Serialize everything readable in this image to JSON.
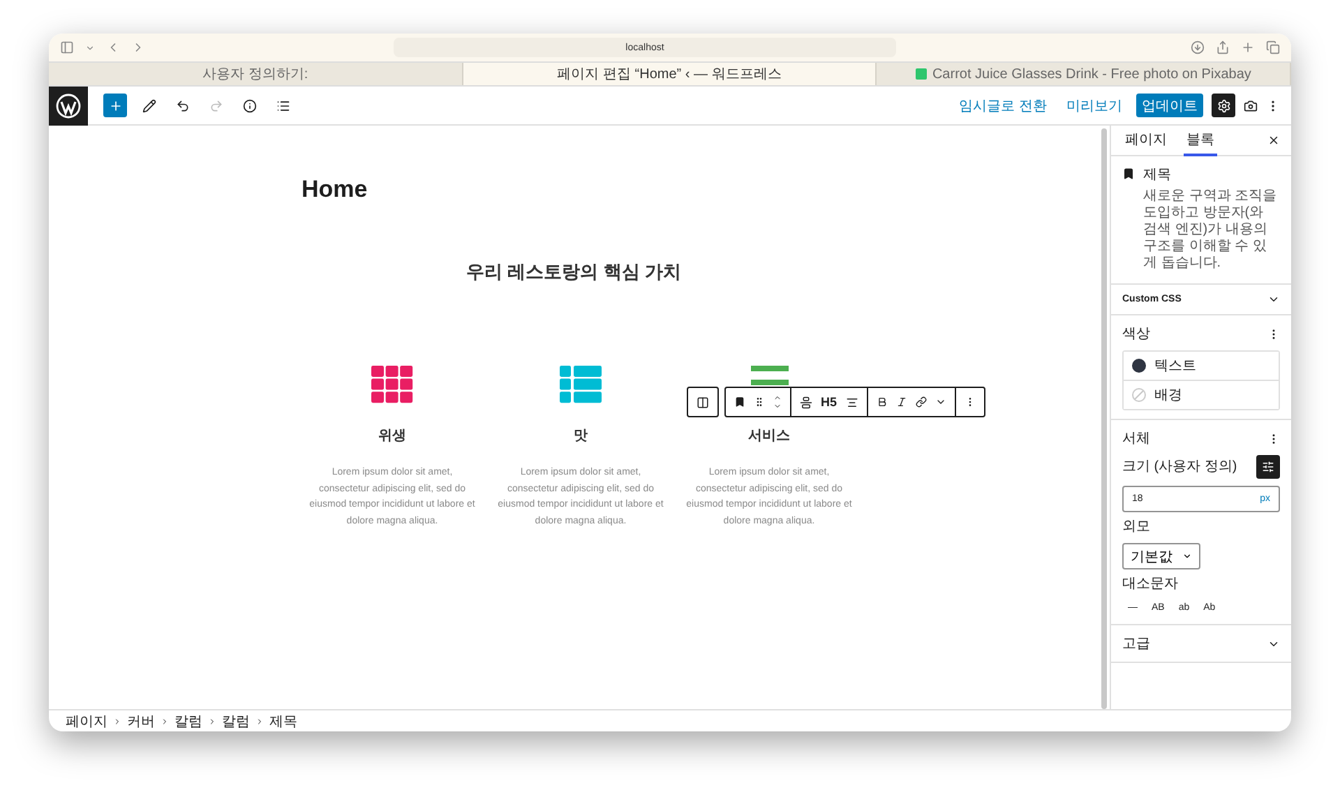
{
  "browser": {
    "address": "localhost",
    "tabs": [
      {
        "title": "사용자 정의하기:",
        "selected": false,
        "favicon": false
      },
      {
        "title": "페이지 편집 “Home” ‹ — 워드프레스",
        "selected": true,
        "favicon": false
      },
      {
        "title": "Carrot Juice Glasses Drink - Free photo on Pixabay",
        "selected": false,
        "favicon": true
      }
    ]
  },
  "toolbar": {
    "tools": [
      {
        "kind": "add",
        "disabled": false
      },
      {
        "kind": "edit",
        "disabled": false
      },
      {
        "kind": "undo",
        "disabled": false
      },
      {
        "kind": "redo",
        "disabled": true
      },
      {
        "kind": "info",
        "disabled": false
      },
      {
        "kind": "outline",
        "disabled": false
      }
    ],
    "actions": [
      {
        "label": "임시글로 전환",
        "kind": "link"
      },
      {
        "label": "미리보기",
        "kind": "link"
      },
      {
        "label": "업데이트",
        "kind": "primary"
      }
    ],
    "settings_selected": true
  },
  "canvas": {
    "title": "Home",
    "heading": "우리 레스토랑의 핵심 가치",
    "features": [
      {
        "kind": "grid",
        "color": "#e91e63",
        "title": "위생",
        "text": "Lorem ipsum dolor sit amet, consectetur adipiscing elit, sed do eiusmod tempor incididunt ut labore et dolore magna aliqua."
      },
      {
        "kind": "rows",
        "color": "#00bcd4",
        "title": "맛",
        "text": "Lorem ipsum dolor sit amet, consectetur adipiscing elit, sed do eiusmod tempor incididunt ut labore et dolore magna aliqua."
      },
      {
        "kind": "bars",
        "color": "#4caf50",
        "title": "서비스",
        "text": "Lorem ipsum dolor sit amet, consectetur adipiscing elit, sed do eiusmod tempor incididunt ut labore et dolore magna aliqua."
      }
    ]
  },
  "block_toolbar": {
    "heading_level": "H5"
  },
  "sidebar": {
    "tabs": [
      {
        "label": "페이지",
        "selected": false
      },
      {
        "label": "블록",
        "selected": true
      }
    ],
    "block": {
      "name": "제목",
      "description": "새로운 구역과 조직을 도입하고 방문자(와 검색 엔진)가 내용의 구조를 이해할 수 있게 돕습니다."
    },
    "custom_css": "Custom CSS",
    "color": {
      "title": "색상",
      "items": [
        {
          "label": "텍스트",
          "color": "#2f3542"
        },
        {
          "label": "배경"
        }
      ]
    },
    "typography": {
      "title": "서체",
      "size_label": "크기 (사용자 정의)",
      "size_value": "18",
      "size_unit": "px",
      "appearance_label": "외모",
      "appearance_value": "기본값",
      "case_label": "대소문자",
      "case_options": [
        "—",
        "AB",
        "ab",
        "Ab"
      ]
    },
    "advanced": "고급"
  },
  "breadcrumb": [
    "페이지",
    "커버",
    "칼럼",
    "칼럼",
    "제목"
  ]
}
